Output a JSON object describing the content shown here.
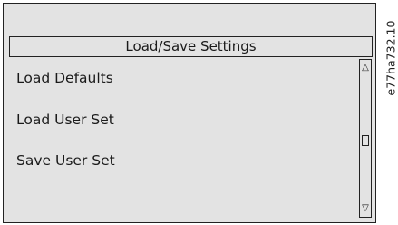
{
  "screen": {
    "title": "Load/Save Settings",
    "menu_items": [
      {
        "label": "Load Defaults"
      },
      {
        "label": "Load User Set"
      },
      {
        "label": "Save User Set"
      }
    ],
    "scrollbar": {
      "up_icon": "scroll-up-arrow",
      "down_icon": "scroll-down-arrow",
      "thumb_position": 0.5
    }
  },
  "figure_code": "e77ha732.10",
  "colors": {
    "background": "#e3e3e3",
    "border": "#222222",
    "text": "#1a1a1a"
  }
}
